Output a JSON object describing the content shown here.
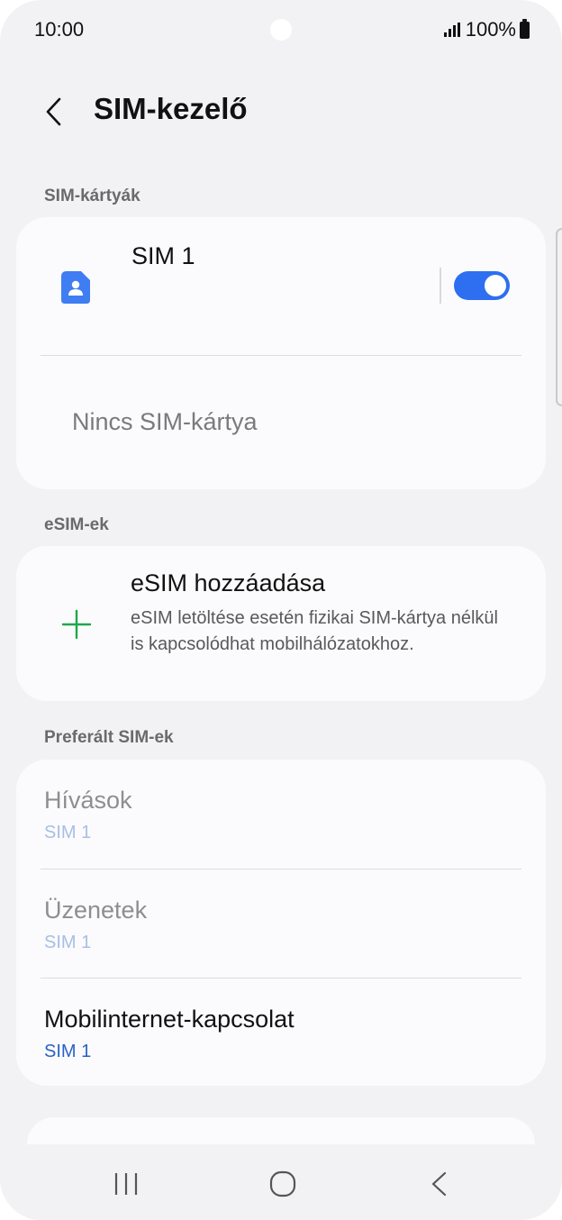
{
  "status_bar": {
    "time": "10:00",
    "battery": "100%"
  },
  "header": {
    "title": "SIM-kezelő"
  },
  "sections": {
    "sim_cards": "SIM-kártyák",
    "esims": "eSIM-ek",
    "preferred": "Preferált SIM-ek"
  },
  "sim_card": {
    "name": "SIM 1",
    "enabled": true,
    "empty_slot": "Nincs SIM-kártya"
  },
  "esim": {
    "add_title": "eSIM hozzáadása",
    "add_desc": "eSIM letöltése esetén fizikai SIM-kártya nélkül is kapcsolódhat mobilhálózatokhoz."
  },
  "preferred": [
    {
      "title": "Hívások",
      "value": "SIM 1",
      "enabled": false
    },
    {
      "title": "Üzenetek",
      "value": "SIM 1",
      "enabled": false
    },
    {
      "title": "Mobilinternet-kapcsolat",
      "value": "SIM 1",
      "enabled": true
    }
  ],
  "colors": {
    "accent": "#2d6ff0",
    "plus": "#1fa84a",
    "background": "#f2f2f4"
  },
  "icons": [
    "back-arrow-icon",
    "sim-card-icon",
    "plus-icon",
    "recent-apps-icon",
    "home-icon",
    "nav-back-icon"
  ]
}
